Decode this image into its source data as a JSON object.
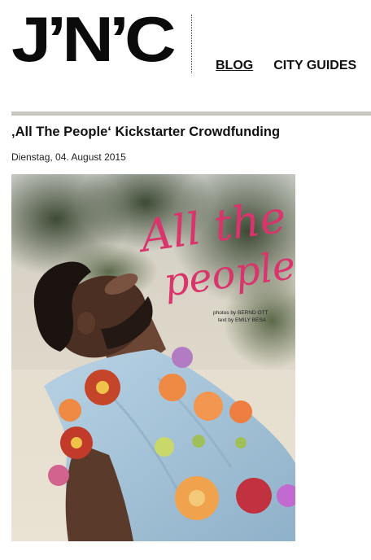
{
  "site": {
    "logo_text": "J’N’C"
  },
  "nav": {
    "items": [
      {
        "label": "BLOG"
      },
      {
        "label": "CITY GUIDES"
      }
    ]
  },
  "post": {
    "title": "‚All The People‘ Kickstarter Crowdfunding",
    "date": "Dienstag, 04. August 2015"
  },
  "hero_image": {
    "headline_line1": "All the",
    "headline_line2": "people",
    "credit_photos": "photos by BERND OTT",
    "credit_text": "text by EMILY BESA"
  },
  "colors": {
    "headline_pink": "#d9346b",
    "rule_gray": "#c9c6c0",
    "shirt_blue": "#a9c7dc"
  }
}
